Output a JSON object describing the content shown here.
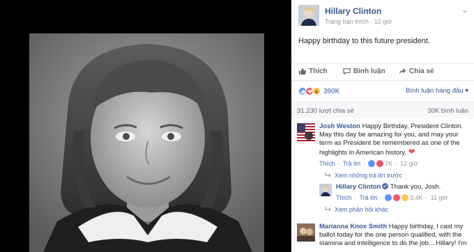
{
  "post": {
    "page_name": "Hillary Clinton",
    "meta_source": "Trang bạn thích",
    "meta_dot": "·",
    "meta_time": "12 giờ",
    "more_glyph": "⌄",
    "text": "Happy birthday to this future president."
  },
  "actions": {
    "like": "Thích",
    "comment": "Bình luận",
    "share": "Chia sẻ"
  },
  "reactions": {
    "count": "390K",
    "sort_label": "Bình luận hàng đầu",
    "sort_glyph": "▾"
  },
  "stats": {
    "shares": "31.230 lượt chia sẻ",
    "views": "30K bình luận"
  },
  "comments": [
    {
      "author": "Josh Weston",
      "text": "Happy Birthday, President Clinton. May this day be amazing for you, and may your term as President be remembered as one of the highlights in American history.",
      "heart": "❤",
      "like": "Thích",
      "reply": "Trả lời",
      "reaction_count": "7K",
      "time": "12 giờ",
      "replies_link": "Xem những trả lời trước"
    },
    {
      "author": "Hillary Clinton",
      "text": "Thank you, Josh.",
      "like": "Thích",
      "reply": "Trả lời",
      "reaction_count": "3,4K",
      "time": "11 giờ",
      "more_link": "Xem phản hồi khác"
    },
    {
      "author": "Marianna Knox Smith",
      "text": "Happy birthday, I cast my ballot today for the one person qualified, with the stamina and intelligence to do the job....Hillary! I'm"
    }
  ],
  "colors": {
    "link": "#365899",
    "like_blue": "#5890ff",
    "love_red": "#f25268",
    "haha_yellow": "#fcc64d"
  },
  "icons": {
    "like": "thumbs-up-icon",
    "comment": "speech-bubble-icon",
    "share": "share-arrow-icon",
    "reply_arrow": "reply-arrow-icon"
  }
}
